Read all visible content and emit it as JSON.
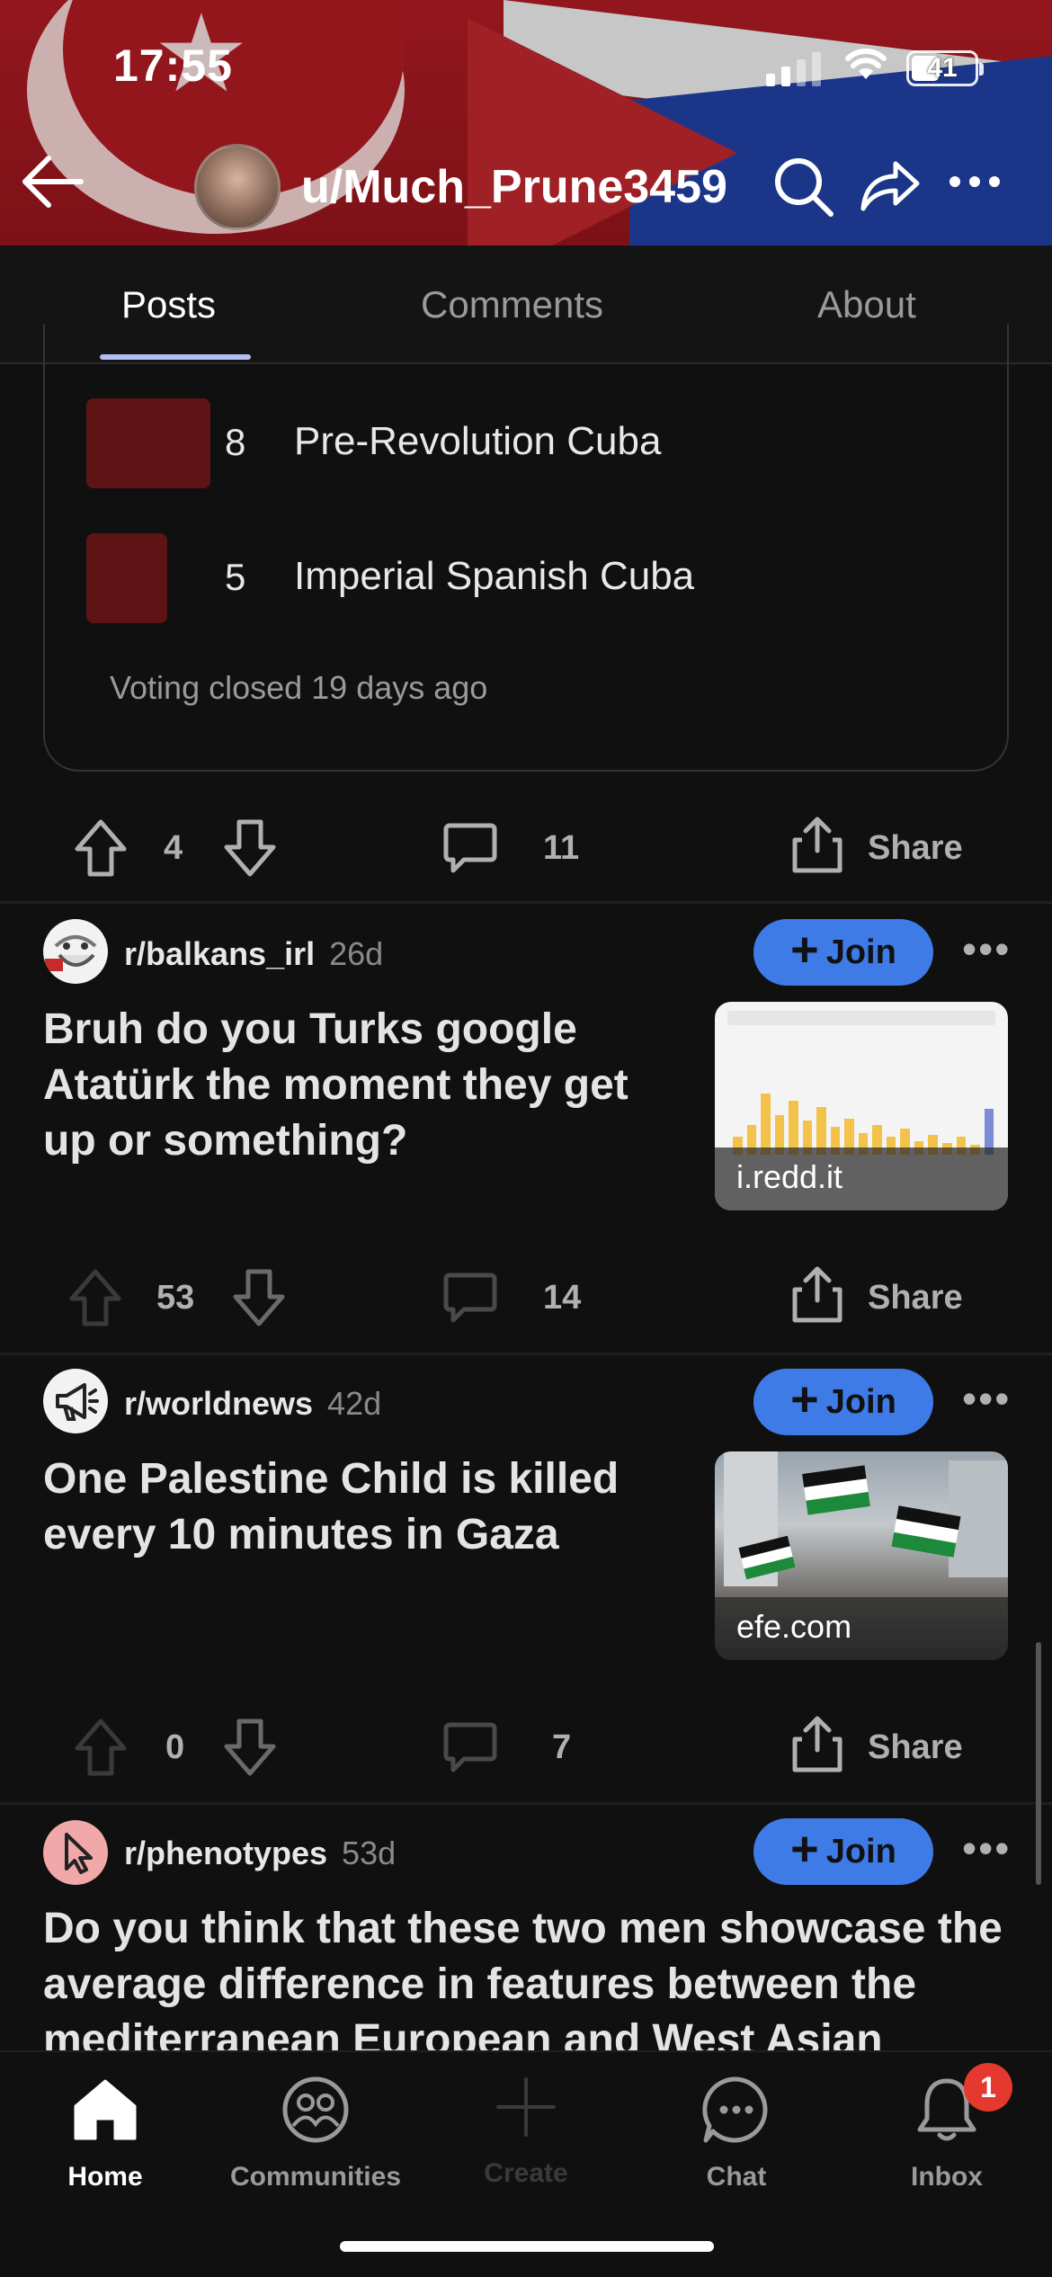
{
  "status_bar": {
    "time": "17:55",
    "battery": "41"
  },
  "header": {
    "username": "u/Much_Prune3459"
  },
  "tabs": [
    {
      "label": "Posts",
      "active": true
    },
    {
      "label": "Comments",
      "active": false
    },
    {
      "label": "About",
      "active": false
    }
  ],
  "poll": {
    "options": [
      {
        "votes": "8",
        "label": "Pre-Revolution Cuba"
      },
      {
        "votes": "5",
        "label": "Imperial Spanish Cuba"
      }
    ],
    "status": "Voting closed 19 days ago",
    "actions": {
      "score": "4",
      "comments": "11",
      "share": "Share"
    }
  },
  "posts": [
    {
      "subreddit": "r/balkans_irl",
      "age": "26d",
      "join": "Join",
      "title": "Bruh do you Turks google Atatürk the moment they get up or something?",
      "thumbnail_domain": "i.redd.it",
      "score": "53",
      "comments": "14",
      "share": "Share"
    },
    {
      "subreddit": "r/worldnews",
      "age": "42d",
      "join": "Join",
      "title": "One Palestine Child is killed every 10 minutes in Gaza",
      "thumbnail_domain": "efe.com",
      "score": "0",
      "comments": "7",
      "share": "Share"
    },
    {
      "subreddit": "r/phenotypes",
      "age": "53d",
      "join": "Join",
      "title": "Do you think that these two men showcase the average difference in features between the mediterranean European and West Asian"
    }
  ],
  "bottom_nav": {
    "home": "Home",
    "communities": "Communities",
    "create": "Create",
    "chat": "Chat",
    "inbox": "Inbox",
    "inbox_badge": "1"
  },
  "colors": {
    "accent_join": "#3f7be6",
    "tab_underline": "#b5bdf5",
    "poll_bar": "#5e1414",
    "badge": "#e5382e"
  }
}
